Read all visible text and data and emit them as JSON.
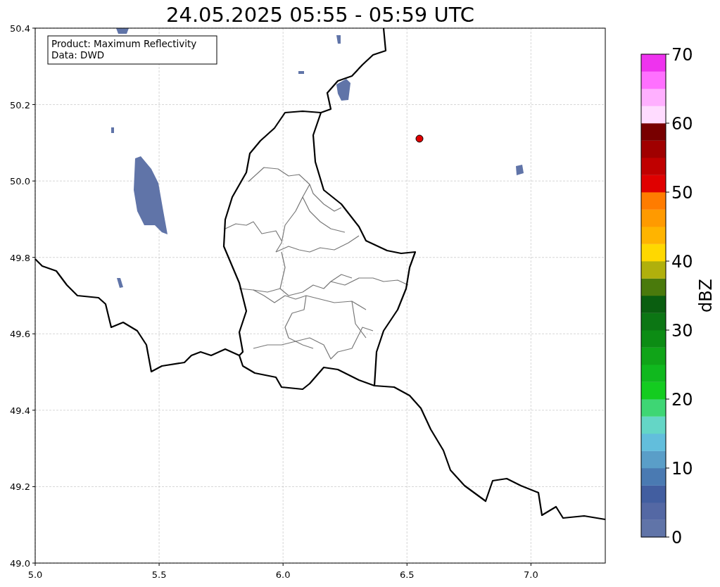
{
  "title": "24.05.2025 05:55 - 05:59 UTC",
  "info_box": {
    "lines": [
      "Product: Maximum Reflectivity",
      "Data: DWD"
    ]
  },
  "map": {
    "x_ticks": [
      "5.0",
      "5.5",
      "6.0",
      "6.5",
      "7.0"
    ],
    "y_ticks": [
      "50.4",
      "50.2",
      "50.0",
      "49.8",
      "49.6",
      "49.4",
      "49.2",
      "49.0"
    ]
  },
  "colorbar": {
    "label": "dBZ",
    "ticks": [
      "70",
      "60",
      "50",
      "40",
      "30",
      "20",
      "10",
      "0"
    ],
    "bins": [
      {
        "color": "#6074a8"
      },
      {
        "color": "#5468a4"
      },
      {
        "color": "#425ea0"
      },
      {
        "color": "#4a7ab2"
      },
      {
        "color": "#5a9ec8"
      },
      {
        "color": "#62bedc"
      },
      {
        "color": "#64d6c6"
      },
      {
        "color": "#3ed674"
      },
      {
        "color": "#14cc20"
      },
      {
        "color": "#10b81e"
      },
      {
        "color": "#10a418"
      },
      {
        "color": "#0c8c14"
      },
      {
        "color": "#0c7614"
      },
      {
        "color": "#0a5e10"
      },
      {
        "color": "#4a7a0c"
      },
      {
        "color": "#b0b00c"
      },
      {
        "color": "#ffd800"
      },
      {
        "color": "#ffb400"
      },
      {
        "color": "#ff9a00"
      },
      {
        "color": "#ff7c00"
      },
      {
        "color": "#e00000"
      },
      {
        "color": "#c00000"
      },
      {
        "color": "#a00000"
      },
      {
        "color": "#780000"
      },
      {
        "color": "#ffdcff"
      },
      {
        "color": "#ffb0ff"
      },
      {
        "color": "#ff70ff"
      },
      {
        "color": "#ee33ee"
      }
    ]
  }
}
